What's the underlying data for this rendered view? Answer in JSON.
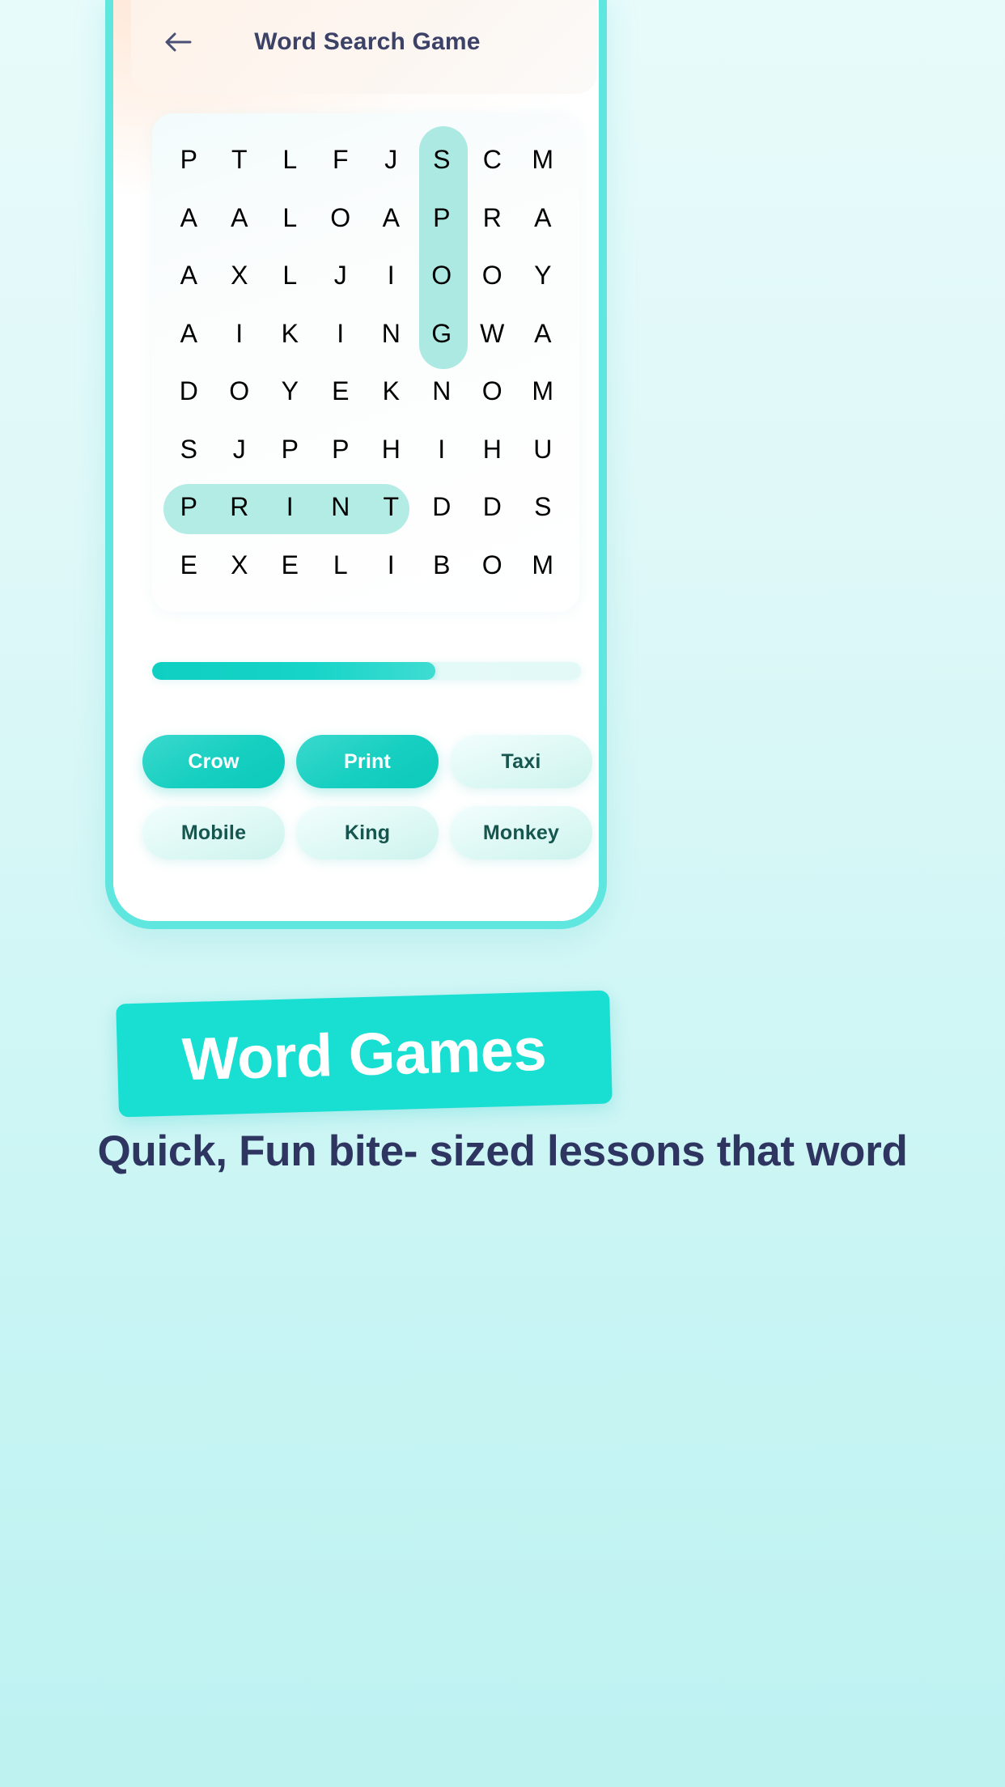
{
  "app": {
    "title": "Word Search Game",
    "back_icon": "arrow-left-icon"
  },
  "grid": {
    "rows": [
      [
        "P",
        "T",
        "L",
        "F",
        "J",
        "S",
        "C",
        "M"
      ],
      [
        "A",
        "A",
        "L",
        "O",
        "A",
        "P",
        "R",
        "A"
      ],
      [
        "A",
        "X",
        "L",
        "J",
        "I",
        "O",
        "O",
        "Y"
      ],
      [
        "A",
        "I",
        "K",
        "I",
        "N",
        "G",
        "W",
        "A"
      ],
      [
        "D",
        "O",
        "Y",
        "E",
        "K",
        "N",
        "O",
        "M"
      ],
      [
        "S",
        "J",
        "P",
        "P",
        "H",
        "I",
        "H",
        "U"
      ],
      [
        "P",
        "R",
        "I",
        "N",
        "T",
        "D",
        "D",
        "S"
      ],
      [
        "E",
        "X",
        "E",
        "L",
        "I",
        "B",
        "O",
        "M"
      ]
    ],
    "highlights": [
      {
        "word": "CROW",
        "orientation": "vertical",
        "col": 6,
        "row_start": 0,
        "row_end": 3
      },
      {
        "word": "PRINT",
        "orientation": "horizontal",
        "row": 6,
        "col_start": 0,
        "col_end": 4
      }
    ]
  },
  "progress": {
    "percent": 66,
    "fill_color": "#10cfc1",
    "track_color": "#e6faf9"
  },
  "words": [
    {
      "label": "Crow",
      "found": true
    },
    {
      "label": "Print",
      "found": true
    },
    {
      "label": "Taxi",
      "found": false
    },
    {
      "label": "Mobile",
      "found": false
    },
    {
      "label": "King",
      "found": false
    },
    {
      "label": "Monkey",
      "found": false
    }
  ],
  "banner": {
    "headline": "Word Games",
    "subheadline": "Quick, Fun bite- sized lessons that word",
    "ribbon_color": "#19dfd2",
    "subheadline_color": "#2e3560"
  },
  "theme": {
    "page_background": "#ccf6f5",
    "phone_border": "#5fe6df",
    "accent": "#16cfc0",
    "title_color": "#3c4267",
    "highlight_color": "#abe9e2"
  }
}
